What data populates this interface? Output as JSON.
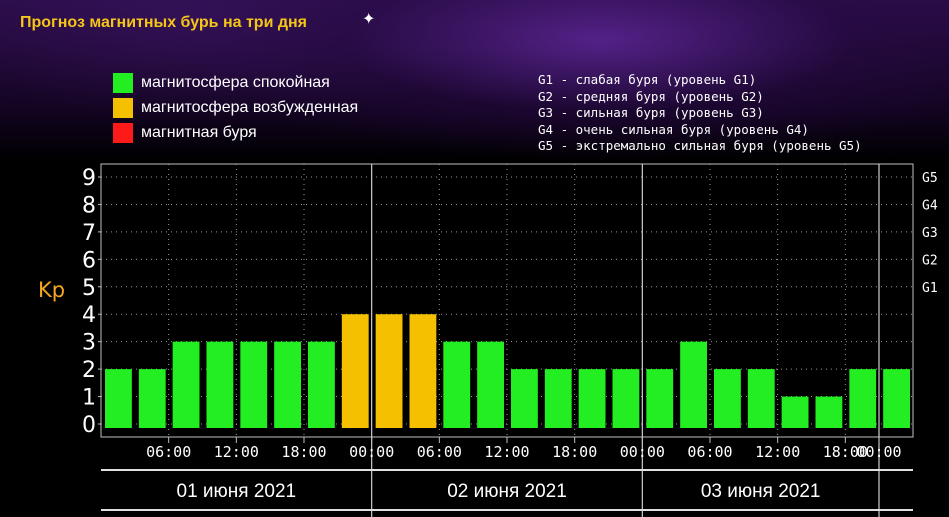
{
  "title": "Прогноз магнитных бурь на три дня",
  "legend": [
    {
      "label": "магнитосфера спокойная",
      "color": "#22ee22"
    },
    {
      "label": "магнитосфера возбужденная",
      "color": "#f5c000"
    },
    {
      "label": "магнитная буря",
      "color": "#ff1a1a"
    }
  ],
  "storm_levels": [
    "G1 - слабая буря (уровень G1)",
    "G2 - средняя буря (уровень G2)",
    "G3 - сильная буря (уровень G3)",
    "G4 - очень сильная буря (уровень G4)",
    "G5 - экстремально сильная буря (уровень G5)"
  ],
  "chart_data": {
    "type": "bar",
    "ylabel": "Kp",
    "ylim": [
      0,
      9
    ],
    "y_ticks": [
      "0",
      "1",
      "2",
      "3",
      "4",
      "5",
      "6",
      "7",
      "8",
      "9"
    ],
    "right_ticks": [
      {
        "label": "G1",
        "kp": 5
      },
      {
        "label": "G2",
        "kp": 6
      },
      {
        "label": "G3",
        "kp": 7
      },
      {
        "label": "G4",
        "kp": 8
      },
      {
        "label": "G5",
        "kp": 9
      }
    ],
    "x_ticks": [
      "06:00",
      "12:00",
      "18:00",
      "00:00",
      "06:00",
      "12:00",
      "18:00",
      "00:00",
      "06:00",
      "12:00",
      "18:00",
      "00:00"
    ],
    "days": [
      "01 июня 2021",
      "02 июня 2021",
      "03 июня 2021"
    ],
    "values": [
      2,
      2,
      3,
      3,
      3,
      3,
      3,
      4,
      4,
      4,
      3,
      3,
      2,
      2,
      2,
      2,
      2,
      3,
      2,
      2,
      1,
      1,
      2,
      2
    ],
    "colors": {
      "quiet": "#22ee22",
      "active": "#f5c000",
      "storm": "#ff1a1a"
    },
    "grid": true
  }
}
